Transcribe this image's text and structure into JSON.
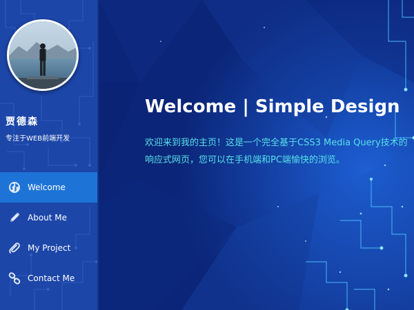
{
  "profile": {
    "name": "贾德森",
    "tagline": "专注于WEB前端开发",
    "avatar": "person-standing-on-pier-photo"
  },
  "nav": {
    "items": [
      {
        "label": "Welcome",
        "icon": "globe-icon",
        "active": true
      },
      {
        "label": "About Me",
        "icon": "pencil-icon",
        "active": false
      },
      {
        "label": "My Project",
        "icon": "paperclip-icon",
        "active": false
      },
      {
        "label": "Contact Me",
        "icon": "link-icon",
        "active": false
      }
    ]
  },
  "hero": {
    "title": "Welcome | Simple Design",
    "description": "欢迎来到我的主页！这是一个完全基于CSS3 Media Query技术的响应式网页，您可以在手机端和PC端愉快的浏览。"
  },
  "colors": {
    "sidebar": "#1c46a8",
    "active_nav": "#1e74d6",
    "main_bg": "#0f2c8a",
    "description_text": "#56e0e8",
    "accent_lights": "#4fc3ff"
  }
}
